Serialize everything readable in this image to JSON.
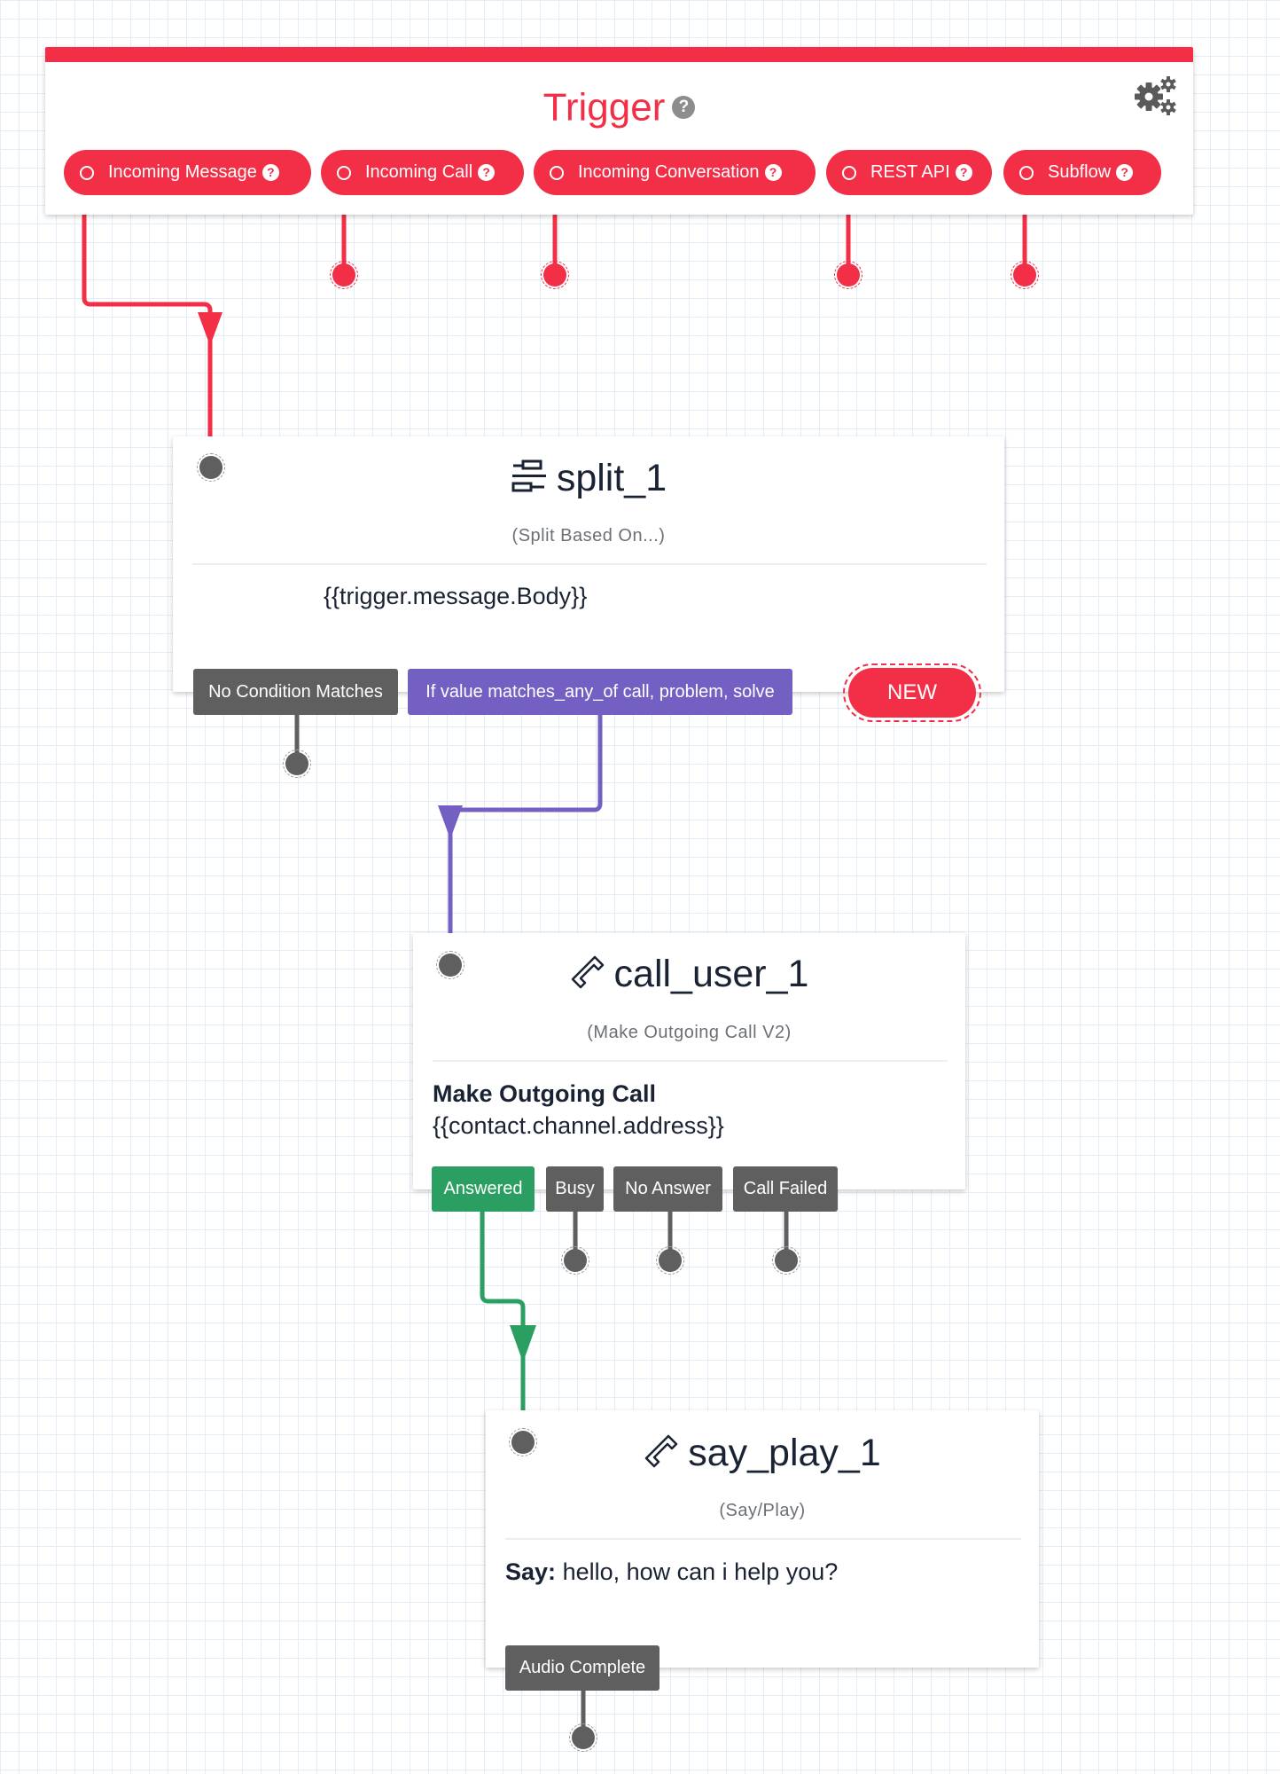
{
  "trigger": {
    "title": "Trigger",
    "help_icon": "question-circle-icon",
    "settings_icon": "gears-icon",
    "accent_color": "#f22f46",
    "pills": [
      {
        "label": "Incoming Message",
        "connected": true
      },
      {
        "label": "Incoming Call",
        "connected": false
      },
      {
        "label": "Incoming Conversation",
        "connected": false
      },
      {
        "label": "REST API",
        "connected": false
      },
      {
        "label": "Subflow",
        "connected": false
      }
    ]
  },
  "nodes": {
    "split": {
      "name": "split_1",
      "type": "(Split Based On...)",
      "icon": "split-icon",
      "body": "{{trigger.message.Body}}",
      "transitions": [
        {
          "label": "No Condition Matches",
          "color": "#5f5f5f"
        },
        {
          "label": "If value matches_any_of call, problem, solve",
          "color": "#7460c3"
        }
      ],
      "new_button": "NEW"
    },
    "call": {
      "name": "call_user_1",
      "type": "(Make Outgoing Call V2)",
      "icon": "phone-icon",
      "body_heading": "Make Outgoing Call",
      "body": "{{contact.channel.address}}",
      "transitions": [
        {
          "label": "Answered",
          "color": "#2b9e61"
        },
        {
          "label": "Busy",
          "color": "#5f5f5f"
        },
        {
          "label": "No Answer",
          "color": "#5f5f5f"
        },
        {
          "label": "Call Failed",
          "color": "#5f5f5f"
        }
      ]
    },
    "say": {
      "name": "say_play_1",
      "type": "(Say/Play)",
      "icon": "phone-icon",
      "body_label": "Say:",
      "body": "hello, how can i help you?",
      "transitions": [
        {
          "label": "Audio Complete",
          "color": "#5f5f5f"
        }
      ]
    }
  }
}
